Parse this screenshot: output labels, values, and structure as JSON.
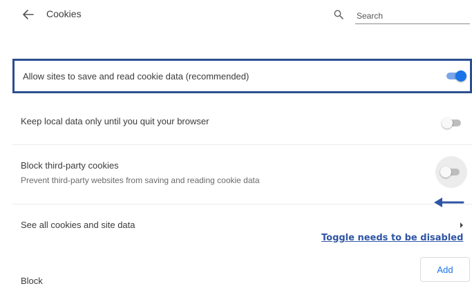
{
  "header": {
    "title": "Cookies",
    "back_icon": "arrow-left-icon",
    "search": {
      "placeholder": "Search",
      "value": ""
    }
  },
  "rows": {
    "allow": {
      "label": "Allow sites to save and read cookie data (recommended)",
      "toggle_on": true,
      "highlighted": true
    },
    "keep_local": {
      "label": "Keep local data only until you quit your browser",
      "toggle_on": false
    },
    "block_third_party": {
      "label": "Block third-party cookies",
      "sublabel": "Prevent third-party websites from saving and reading cookie data",
      "toggle_on": false
    },
    "see_all": {
      "label": "See all cookies and site data",
      "icon": "chevron-right-icon"
    },
    "block": {
      "label": "Block",
      "add_label": "Add"
    }
  },
  "annotation": {
    "text": "Toggle needs to be disabled",
    "color": "#2f55a4",
    "highlight_border_color": "#2a4f8f"
  },
  "colors": {
    "accent": "#1a73e8",
    "toggle_on_track": "#7aa6e8",
    "toggle_off_track": "#bdbdbd"
  }
}
